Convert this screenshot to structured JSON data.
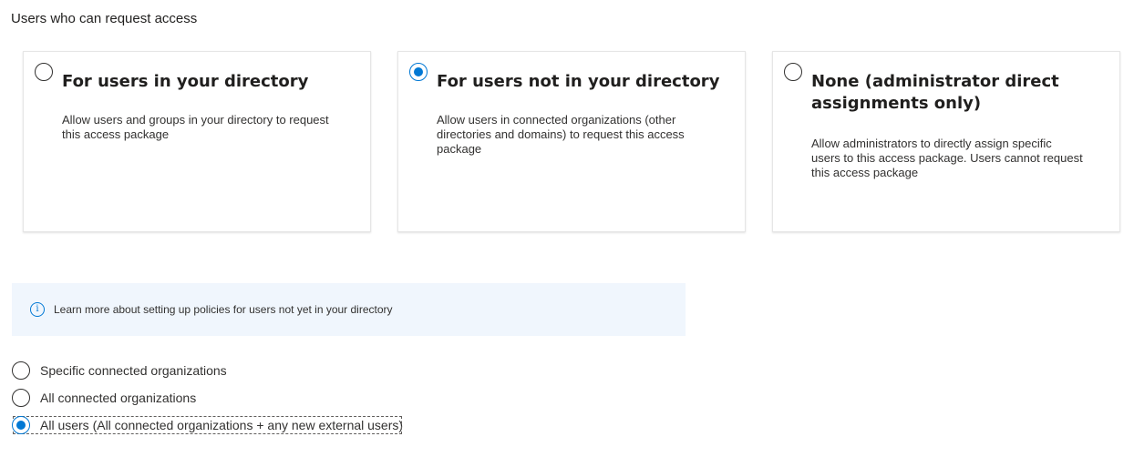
{
  "section_title": "Users who can request access",
  "cards": [
    {
      "title": "For users in your directory",
      "description": "Allow users and groups in your directory to request this access package",
      "selected": false
    },
    {
      "title": "For users not in your directory",
      "description": "Allow users in connected organizations (other directories and domains) to request this access package",
      "selected": true
    },
    {
      "title": "None (administrator direct assignments only)",
      "description": "Allow administrators to directly assign specific users to this access package. Users cannot request this access package",
      "selected": false
    }
  ],
  "info": {
    "icon": "info-icon",
    "text": "Learn more about setting up policies for users not yet in your directory"
  },
  "options": [
    {
      "label": "Specific connected organizations",
      "selected": false
    },
    {
      "label": "All connected organizations",
      "selected": false
    },
    {
      "label": "All users (All connected organizations + any new external users)",
      "selected": true
    }
  ],
  "colors": {
    "accent": "#0078d4",
    "info_background": "#f0f6fd"
  }
}
